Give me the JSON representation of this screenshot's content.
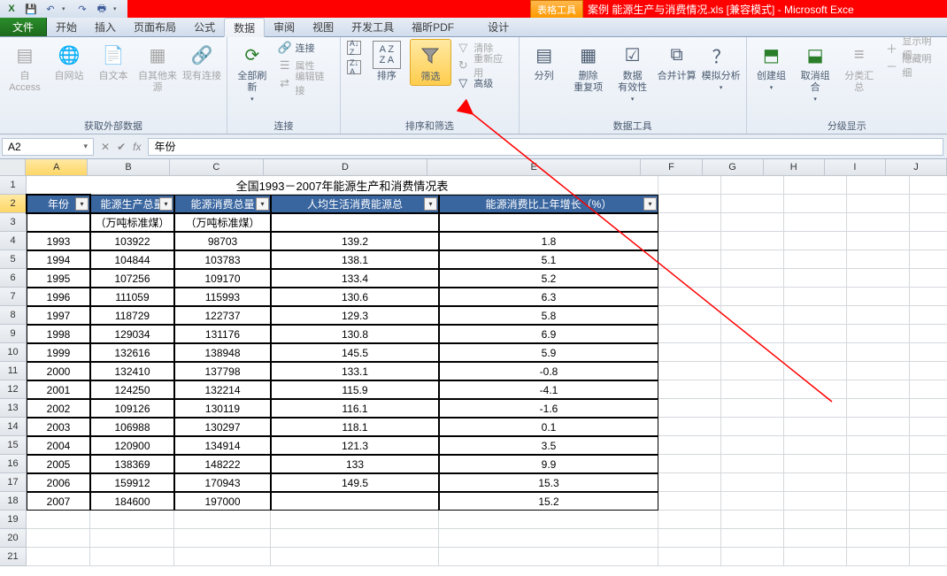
{
  "app": {
    "title_left": "案例 能源生产与消费情况.xls [兼容模式] - Microsoft Exce",
    "tab_tools_label": "表格工具"
  },
  "qat": {
    "save": "💾",
    "undo": "↶",
    "redo": "↷",
    "print": "🖶"
  },
  "tabs": {
    "file": "文件",
    "home": "开始",
    "insert": "插入",
    "layout": "页面布局",
    "formulas": "公式",
    "data": "数据",
    "review": "审阅",
    "view": "视图",
    "dev": "开发工具",
    "foxit": "福昕PDF",
    "design": "设计"
  },
  "ribbon": {
    "ext": {
      "label": "获取外部数据",
      "access": "自 Access",
      "web": "自网站",
      "text": "自文本",
      "other": "自其他来源",
      "conn": "现有连接"
    },
    "connections": {
      "label": "连接",
      "refresh": "全部刷新",
      "conn": "连接",
      "prop": "属性",
      "edit": "编辑链接"
    },
    "sortfilter": {
      "label": "排序和筛选",
      "sort": "排序",
      "filter": "筛选",
      "clear": "清除",
      "reapply": "重新应用",
      "advanced": "高级",
      "az": "A→Z",
      "za": "Z→A"
    },
    "datatools": {
      "label": "数据工具",
      "t2c": "分列",
      "dedup": "删除\n重复项",
      "validate": "数据\n有效性",
      "consolidate": "合并计算",
      "whatif": "模拟分析"
    },
    "outline": {
      "label": "分级显示",
      "group": "创建组",
      "ungroup": "取消组合",
      "subtotal": "分类汇总",
      "showdetail": "显示明细",
      "hidedetail": "隐藏明细"
    }
  },
  "namebox": "A2",
  "formula": "年份",
  "columns": [
    "A",
    "B",
    "C",
    "D",
    "E",
    "F",
    "G",
    "H",
    "I",
    "J"
  ],
  "table": {
    "title": "全国1993－2007年能源生产和消费情况表",
    "headers": [
      "年份",
      "能源生产总量",
      "能源消费总量",
      "人均生活消费能源总",
      "能源消费比上年增长（%）"
    ],
    "subheaders": [
      "",
      "（万吨标准煤）",
      "（万吨标准煤）",
      "",
      ""
    ],
    "rows": [
      [
        "1993",
        "103922",
        "98703",
        "139.2",
        "1.8"
      ],
      [
        "1994",
        "104844",
        "103783",
        "138.1",
        "5.1"
      ],
      [
        "1995",
        "107256",
        "109170",
        "133.4",
        "5.2"
      ],
      [
        "1996",
        "111059",
        "115993",
        "130.6",
        "6.3"
      ],
      [
        "1997",
        "118729",
        "122737",
        "129.3",
        "5.8"
      ],
      [
        "1998",
        "129034",
        "131176",
        "130.8",
        "6.9"
      ],
      [
        "1999",
        "132616",
        "138948",
        "145.5",
        "5.9"
      ],
      [
        "2000",
        "132410",
        "137798",
        "133.1",
        "-0.8"
      ],
      [
        "2001",
        "124250",
        "132214",
        "115.9",
        "-4.1"
      ],
      [
        "2002",
        "109126",
        "130119",
        "116.1",
        "-1.6"
      ],
      [
        "2003",
        "106988",
        "130297",
        "118.1",
        "0.1"
      ],
      [
        "2004",
        "120900",
        "134914",
        "121.3",
        "3.5"
      ],
      [
        "2005",
        "138369",
        "148222",
        "133",
        "9.9"
      ],
      [
        "2006",
        "159912",
        "170943",
        "149.5",
        "15.3"
      ],
      [
        "2007",
        "184600",
        "197000",
        "",
        "15.2"
      ]
    ]
  },
  "chart_data": {
    "type": "table",
    "title": "全国1993－2007年能源生产和消费情况表",
    "columns": [
      "年份",
      "能源生产总量(万吨标准煤)",
      "能源消费总量(万吨标准煤)",
      "人均生活消费能源",
      "能源消费比上年增长(%)"
    ],
    "rows": [
      [
        1993,
        103922,
        98703,
        139.2,
        1.8
      ],
      [
        1994,
        104844,
        103783,
        138.1,
        5.1
      ],
      [
        1995,
        107256,
        109170,
        133.4,
        5.2
      ],
      [
        1996,
        111059,
        115993,
        130.6,
        6.3
      ],
      [
        1997,
        118729,
        122737,
        129.3,
        5.8
      ],
      [
        1998,
        129034,
        131176,
        130.8,
        6.9
      ],
      [
        1999,
        132616,
        138948,
        145.5,
        5.9
      ],
      [
        2000,
        132410,
        137798,
        133.1,
        -0.8
      ],
      [
        2001,
        124250,
        132214,
        115.9,
        -4.1
      ],
      [
        2002,
        109126,
        130119,
        116.1,
        -1.6
      ],
      [
        2003,
        106988,
        130297,
        118.1,
        0.1
      ],
      [
        2004,
        120900,
        134914,
        121.3,
        3.5
      ],
      [
        2005,
        138369,
        148222,
        133,
        9.9
      ],
      [
        2006,
        159912,
        170943,
        149.5,
        15.3
      ],
      [
        2007,
        184600,
        197000,
        null,
        15.2
      ]
    ]
  }
}
